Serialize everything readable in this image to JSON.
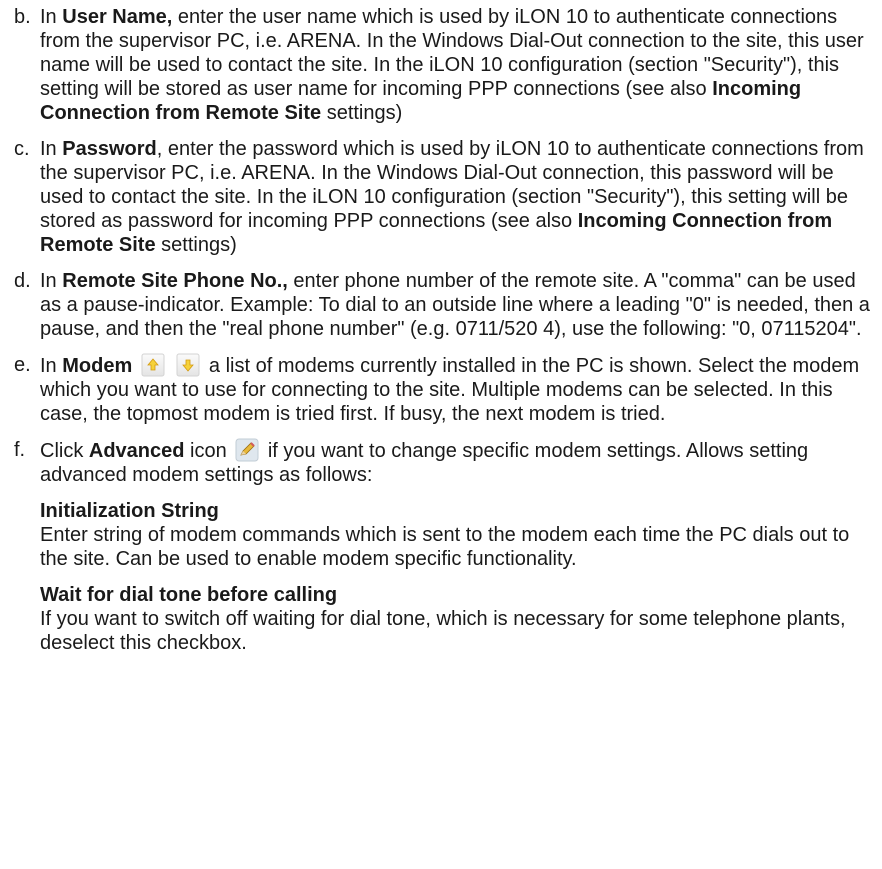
{
  "items": [
    {
      "marker": "b.",
      "segments": [
        {
          "t": "In ",
          "b": false
        },
        {
          "t": "User Name,",
          "b": true
        },
        {
          "t": " enter the user name which is used by iLON 10 to authenticate connections from the supervisor PC, i.e. ARENA. In the Windows Dial-Out connection to the site, this user name will be used to contact the site. In the iLON 10 configuration (section \"Security\"), this setting will be stored as user name for incoming PPP connections (see also ",
          "b": false
        },
        {
          "t": "Incoming Connection from Remote Site",
          "b": true
        },
        {
          "t": " settings)",
          "b": false
        }
      ]
    },
    {
      "marker": "c.",
      "segments": [
        {
          "t": "In ",
          "b": false
        },
        {
          "t": "Password",
          "b": true
        },
        {
          "t": ", enter the password which is used by iLON 10 to authenticate connections from the supervisor PC, i.e. ARENA. In the Windows Dial-Out connection, this password will be used to contact the site. In the iLON 10 configuration (section \"Security\"), this setting will be stored as password for incoming PPP connections (see also ",
          "b": false
        },
        {
          "t": "Incoming Connection from Remote Site",
          "b": true
        },
        {
          "t": " settings)",
          "b": false
        }
      ]
    },
    {
      "marker": "d.",
      "segments": [
        {
          "t": "In ",
          "b": false
        },
        {
          "t": "Remote Site Phone No.,",
          "b": true
        },
        {
          "t": " enter phone number of the remote site. A \"comma\" can be used as a pause-indicator. Example: To dial to an outside line where a leading \"0\" is needed, then a pause, and then the \"real phone number\" (e.g. 0711/520 4), use the following: \"0, 07115204\".",
          "b": false
        }
      ]
    },
    {
      "marker": "e.",
      "pre": {
        "t1": "In ",
        "bold": "Modem"
      },
      "icons": [
        "move-up-icon",
        "move-down-icon"
      ],
      "post": " a list of modems currently installed in the PC is shown. Select the modem which you want to use for connecting to the site. Multiple modems can be selected. In this case, the topmost modem is tried first. If busy, the next modem is tried."
    },
    {
      "marker": "f.",
      "pre": {
        "t1": "Click ",
        "bold": "Advanced",
        "t2": " icon"
      },
      "icon": "edit-pencil-icon",
      "post": " if you want to change specific modem settings. Allows setting advanced modem settings as follows:",
      "subs": [
        {
          "heading": "Initialization String",
          "text": "Enter string of modem commands which is sent to the modem each time the PC dials out to the site. Can be used to enable modem specific functionality."
        },
        {
          "heading": "Wait for dial tone before calling",
          "text": "If you want to switch off waiting for dial tone, which is necessary for some telephone plants, deselect this checkbox."
        }
      ]
    }
  ]
}
